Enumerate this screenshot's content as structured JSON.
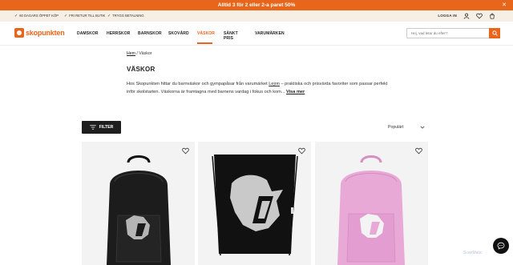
{
  "promo": {
    "text": "Alltid 3 för 2 eller 2-a paret 50%",
    "close": "✕"
  },
  "usp": {
    "items": [
      "60 DAGARS ÖPPET KÖP",
      "FRI RETUR TILL BUTIK",
      "TRYGG BETALNING"
    ],
    "login": "LOGGA IN"
  },
  "brand": {
    "name": "skopunkten",
    "accent": "#e8651c"
  },
  "nav": {
    "items": [
      "DAMSKOR",
      "HERRSKOR",
      "BARNSKOR",
      "SKOVÅRD",
      "VÄSKOR",
      "SÄNKT PRIS",
      "VARUMÄRKEN"
    ],
    "active": "VÄSKOR"
  },
  "search": {
    "placeholder": "Hej, vad letar du efter?"
  },
  "breadcrumb": {
    "home": "Hem",
    "separator": "/",
    "current": "Väskor"
  },
  "page": {
    "title": "VÄSKOR",
    "desc_before": "Hos Skopunkten hittar du barnväskor och gympapåsar från varumärket ",
    "desc_link": "Lejon",
    "desc_after": " – praktiska och prisvärda favoriter som passar perfekt inför skolstarten. Väskorna är framtagna med barnens vardag i fokus och kom...",
    "more": "Visa mer"
  },
  "toolbar": {
    "filter": "FILTER",
    "sort": "Populärt"
  },
  "products": [
    {
      "name": "backpack-black",
      "color": "#1c1c1c"
    },
    {
      "name": "gymbag-black",
      "color": "#111111"
    },
    {
      "name": "backpack-pink",
      "color": "#e9a9d6"
    }
  ],
  "watermark": "ScanMatic"
}
